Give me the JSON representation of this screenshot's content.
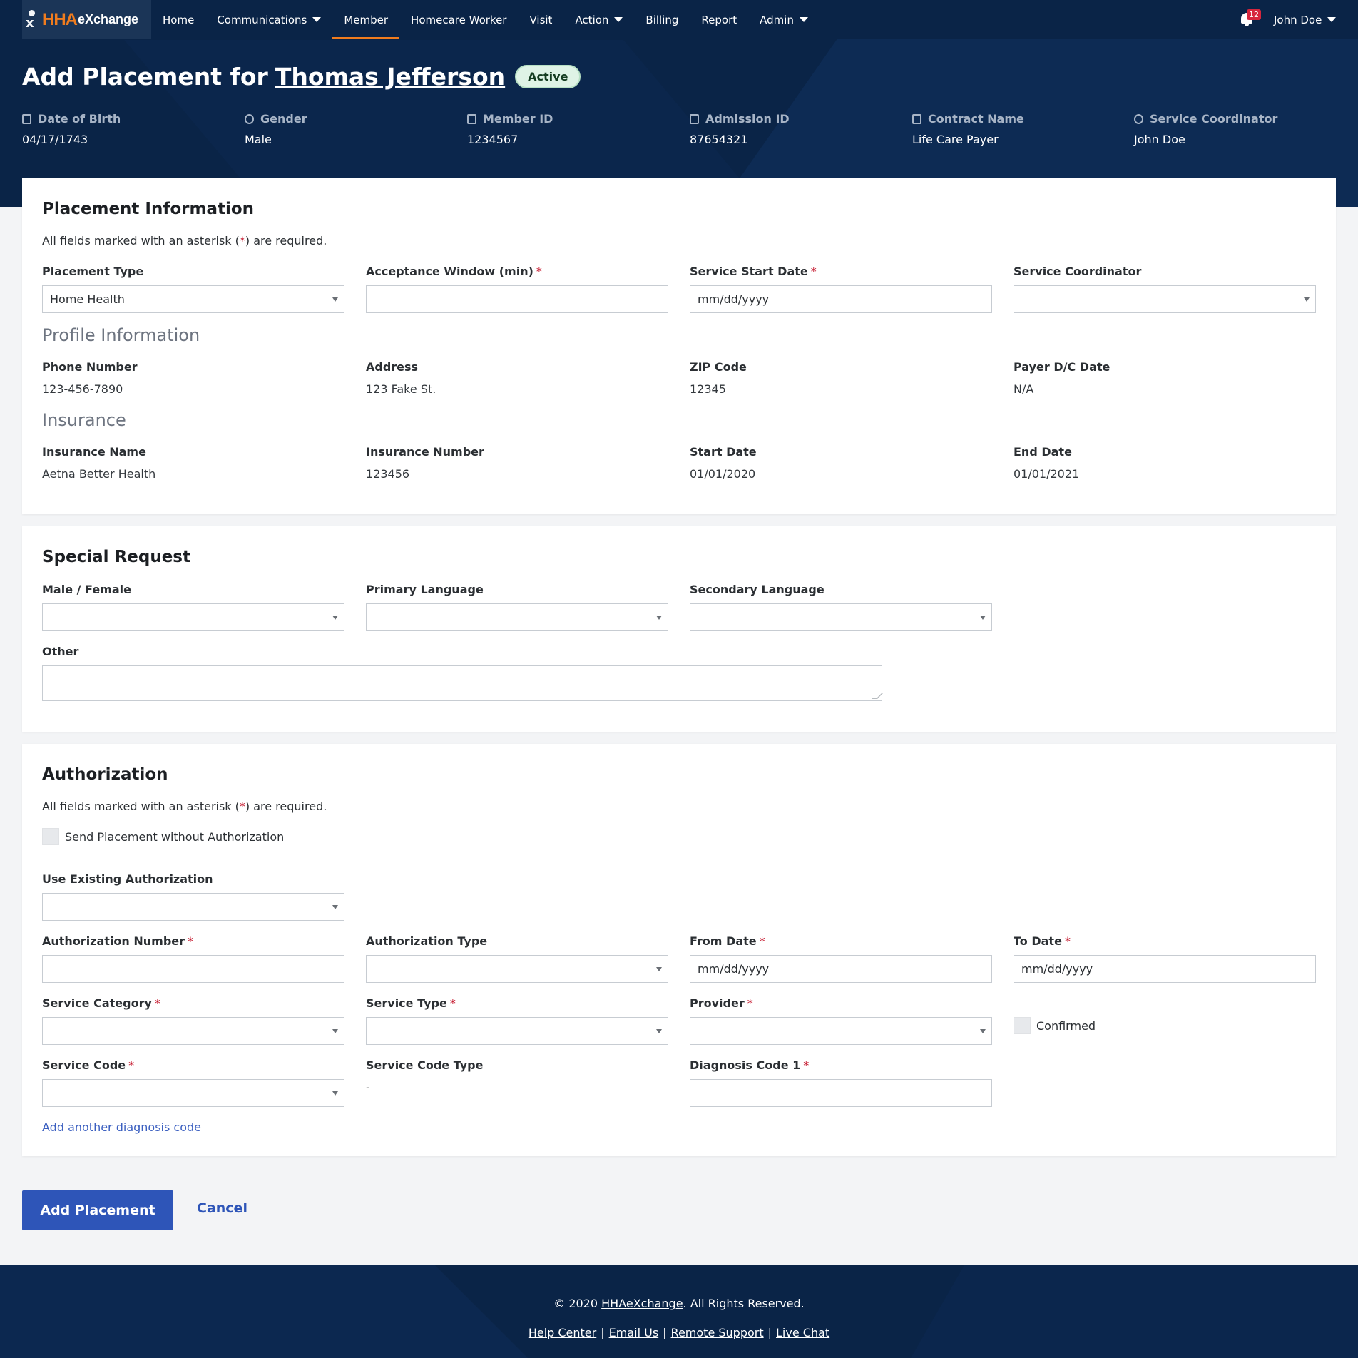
{
  "brand": {
    "logo_hha": "HHA",
    "logo_exchange": "eXchange"
  },
  "nav": {
    "items": [
      {
        "label": "Home"
      },
      {
        "label": "Communications"
      },
      {
        "label": "Member"
      },
      {
        "label": "Homecare Worker"
      },
      {
        "label": "Visit"
      },
      {
        "label": "Action"
      },
      {
        "label": "Billing"
      },
      {
        "label": "Report"
      },
      {
        "label": "Admin"
      }
    ],
    "notifications_count": "12",
    "user_name": "John Doe"
  },
  "header": {
    "title_prefix": "Add Placement for",
    "member_name": "Thomas Jefferson",
    "status": "Active",
    "meta": [
      {
        "label": "Date of Birth",
        "value": "04/17/1743",
        "icon": "calendar-icon"
      },
      {
        "label": "Gender",
        "value": "Male",
        "icon": "gender-icon"
      },
      {
        "label": "Member ID",
        "value": "1234567",
        "icon": "id-badge-icon"
      },
      {
        "label": "Admission ID",
        "value": "87654321",
        "icon": "id-card-icon"
      },
      {
        "label": "Contract Name",
        "value": "Life Care Payer",
        "icon": "document-icon"
      },
      {
        "label": "Service Coordinator",
        "value": "John Doe",
        "icon": "user-circle-icon"
      }
    ]
  },
  "placement": {
    "title": "Placement Information",
    "required_note_pre": "All fields marked with an asterisk (",
    "required_note_ast": "*",
    "required_note_post": ") are required.",
    "fields": {
      "placement_type_label": "Placement Type",
      "placement_type_value": "Home Health",
      "acceptance_label": "Acceptance Window (min)",
      "service_start_label": "Service Start Date",
      "service_start_placeholder": "mm/dd/yyyy",
      "service_coordinator_label": "Service Coordinator"
    },
    "profile": {
      "title": "Profile Information",
      "phone_label": "Phone Number",
      "phone": "123-456-7890",
      "address_label": "Address",
      "address": "123 Fake St.",
      "zip_label": "ZIP Code",
      "zip": "12345",
      "dc_label": "Payer D/C Date",
      "dc": "N/A"
    },
    "insurance": {
      "title": "Insurance",
      "name_label": "Insurance Name",
      "name": "Aetna Better Health",
      "number_label": "Insurance Number",
      "number": "123456",
      "start_label": "Start Date",
      "start": "01/01/2020",
      "end_label": "End Date",
      "end": "01/01/2021"
    }
  },
  "special": {
    "title": "Special Request",
    "gender_label": "Male / Female",
    "primary_lang_label": "Primary Language",
    "secondary_lang_label": "Secondary Language",
    "other_label": "Other"
  },
  "auth": {
    "title": "Authorization",
    "send_without_label": "Send Placement without Authorization",
    "use_existing_label": "Use Existing Authorization",
    "auth_number_label": "Authorization Number",
    "auth_type_label": "Authorization Type",
    "from_label": "From Date",
    "to_label": "To Date",
    "date_placeholder": "mm/dd/yyyy",
    "service_category_label": "Service Category",
    "service_type_label": "Service Type",
    "provider_label": "Provider",
    "confirmed_label": "Confirmed",
    "service_code_label": "Service Code",
    "service_code_type_label": "Service Code Type",
    "service_code_type_value": "-",
    "diagnosis_label": "Diagnosis Code 1",
    "add_diagnosis": "Add another diagnosis code"
  },
  "actions": {
    "submit": "Add Placement",
    "cancel": "Cancel"
  },
  "footer": {
    "copy_pre": "© 2020 ",
    "copy_link": "HHAeXchange",
    "copy_post": ". All Rights Reserved.",
    "links": [
      "Help Center",
      "Email Us",
      "Remote Support",
      "Live Chat"
    ],
    "separator": "|"
  },
  "colors": {
    "navy": "#0a2447",
    "accent": "#f07c1e",
    "primary_button": "#2e55b8",
    "required": "#c5162c"
  }
}
